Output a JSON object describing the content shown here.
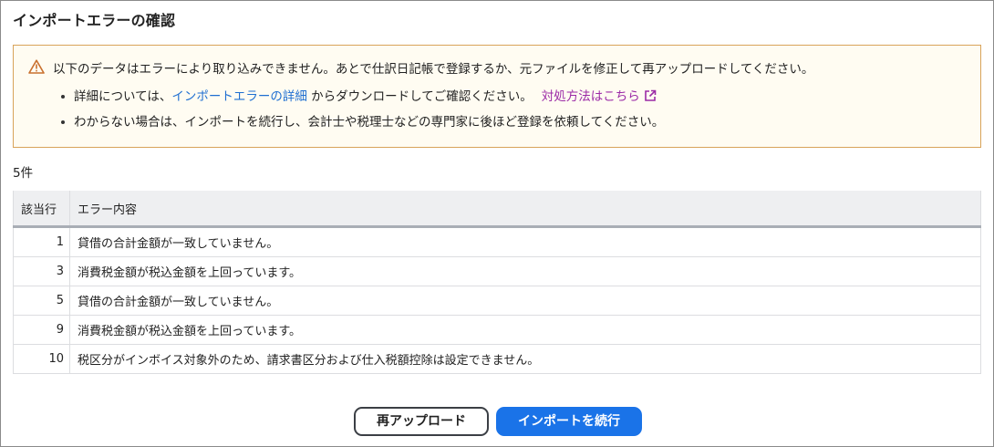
{
  "dialog": {
    "title": "インポートエラーの確認"
  },
  "alert": {
    "icon": "warning-triangle-icon",
    "border_color": "#d8a35a",
    "main_message": "以下のデータはエラーにより取り込みできません。あとで仕訳日記帳で登録するか、元ファイルを修正して再アップロードしてください。",
    "bullet1_prefix": "詳細については、",
    "bullet1_link": "インポートエラーの詳細",
    "bullet1_suffix": " からダウンロードしてご確認ください。",
    "bullet1_help_link": "対処方法はこちら",
    "bullet1_help_icon": "external-link-icon",
    "bullet2": "わからない場合は、インポートを続行し、会計士や税理士などの専門家に後ほど登録を依頼してください。"
  },
  "count_label": "5件",
  "table": {
    "headers": [
      "該当行",
      "エラー内容"
    ],
    "rows": [
      {
        "row": "1",
        "message": "貸借の合計金額が一致していません。"
      },
      {
        "row": "3",
        "message": "消費税金額が税込金額を上回っています。"
      },
      {
        "row": "5",
        "message": "貸借の合計金額が一致していません。"
      },
      {
        "row": "9",
        "message": "消費税金額が税込金額を上回っています。"
      },
      {
        "row": "10",
        "message": "税区分がインボイス対象外のため、請求書区分および仕入税額控除は設定できません。"
      }
    ]
  },
  "buttons": {
    "reupload_label": "再アップロード",
    "continue_label": "インポートを続行"
  },
  "colors": {
    "primary": "#1a73e8",
    "link": "#1f6fd1",
    "help_link": "#9b2aa6"
  }
}
